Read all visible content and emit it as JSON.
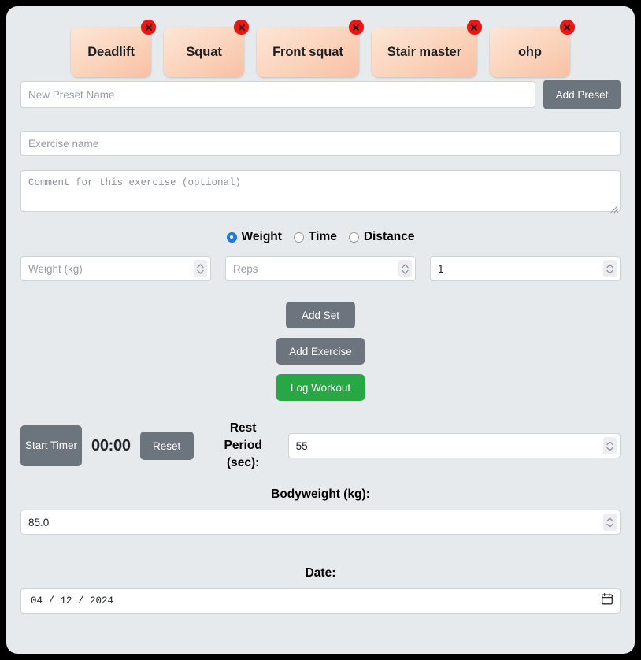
{
  "app": {
    "background_color": "#e7eaed",
    "accent_gray": "#6c757d",
    "accent_green": "#28a745",
    "chip_color": "#fbd3bb",
    "delete_badge_color": "#ef1515",
    "radio_selected_color": "#1e7ae8"
  },
  "presets": {
    "items": [
      {
        "label": "Deadlift",
        "delete_icon": "close-x-icon"
      },
      {
        "label": "Squat",
        "delete_icon": "close-x-icon"
      },
      {
        "label": "Front squat",
        "delete_icon": "close-x-icon"
      },
      {
        "label": "Stair master",
        "delete_icon": "close-x-icon"
      },
      {
        "label": "ohp",
        "delete_icon": "close-x-icon"
      }
    ],
    "new_preset_placeholder": "New Preset Name",
    "new_preset_value": "",
    "add_button_label": "Add Preset"
  },
  "exercise": {
    "name_placeholder": "Exercise name",
    "name_value": "",
    "comment_placeholder": "Comment for this exercise (optional)",
    "comment_value": "",
    "resize_handle_icon": "resize-grip-icon"
  },
  "measure_type": {
    "options": [
      {
        "label": "Weight",
        "selected": true
      },
      {
        "label": "Time",
        "selected": false
      },
      {
        "label": "Distance",
        "selected": false
      }
    ]
  },
  "set_inputs": {
    "weight_placeholder": "Weight (kg)",
    "weight_value": "",
    "reps_placeholder": "Reps",
    "reps_value": "",
    "sets_placeholder": "",
    "sets_value": "1",
    "spinner_icon": "spinner-updown-icon"
  },
  "actions": {
    "add_set_label": "Add Set",
    "add_exercise_label": "Add Exercise",
    "log_workout_label": "Log Workout"
  },
  "timer": {
    "start_label": "Start Timer",
    "display": "00:00",
    "reset_label": "Reset",
    "rest_period_label": "Rest Period (sec):",
    "rest_period_value": "55"
  },
  "bodyweight": {
    "label": "Bodyweight (kg):",
    "value": "85.0"
  },
  "date": {
    "label": "Date:",
    "value": "04 / 12 / 2024",
    "calendar_icon": "calendar-icon"
  }
}
